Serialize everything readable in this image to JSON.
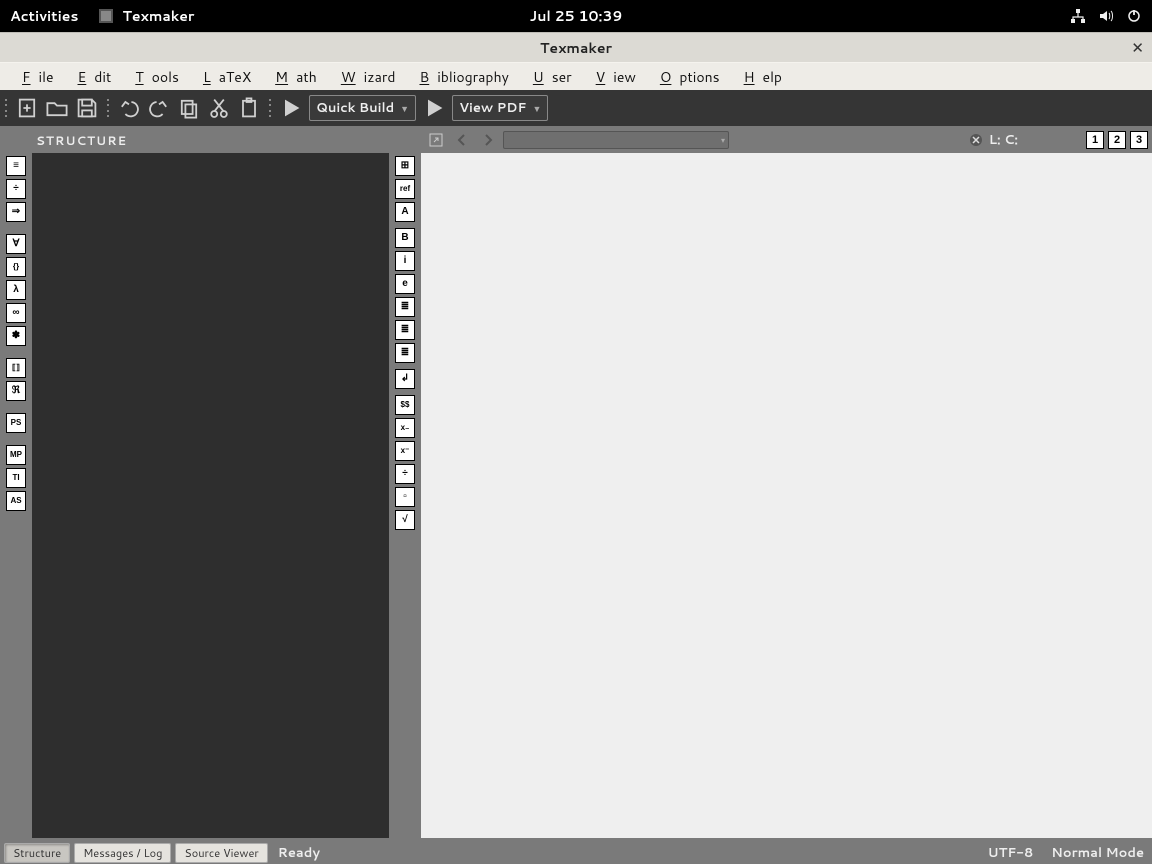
{
  "gnome": {
    "activities": "Activities",
    "app_name": "Texmaker",
    "clock": "Jul 25  10:39"
  },
  "window": {
    "title": "Texmaker"
  },
  "menu": {
    "file": "File",
    "edit": "Edit",
    "tools": "Tools",
    "latex": "LaTeX",
    "math": "Math",
    "wizard": "Wizard",
    "bibliography": "Bibliography",
    "user": "User",
    "view": "View",
    "options": "Options",
    "help": "Help"
  },
  "toolbar": {
    "quick_build": "Quick Build",
    "view_pdf": "View PDF"
  },
  "structure": {
    "title": "STRUCTURE"
  },
  "editor": {
    "line_col": "L:  C:",
    "panels": [
      "1",
      "2",
      "3"
    ]
  },
  "left_icons": [
    "≡",
    "÷",
    "⇒",
    "∀",
    "{}",
    "λ",
    "∞",
    "✽",
    "⟦⟧",
    "ℜ",
    "PS",
    "MP",
    "TI",
    "AS"
  ],
  "mid_icons": [
    "⊞",
    "ref",
    "A",
    "B",
    "i",
    "e",
    "≣",
    "≣",
    "≣",
    "↲",
    "$$",
    "x₋",
    "x⁻",
    "÷",
    "▫",
    "√"
  ],
  "statusbar": {
    "structure": "Structure",
    "messages": "Messages / Log",
    "source": "Source Viewer",
    "ready": "Ready",
    "encoding": "UTF-8",
    "mode": "Normal Mode"
  }
}
